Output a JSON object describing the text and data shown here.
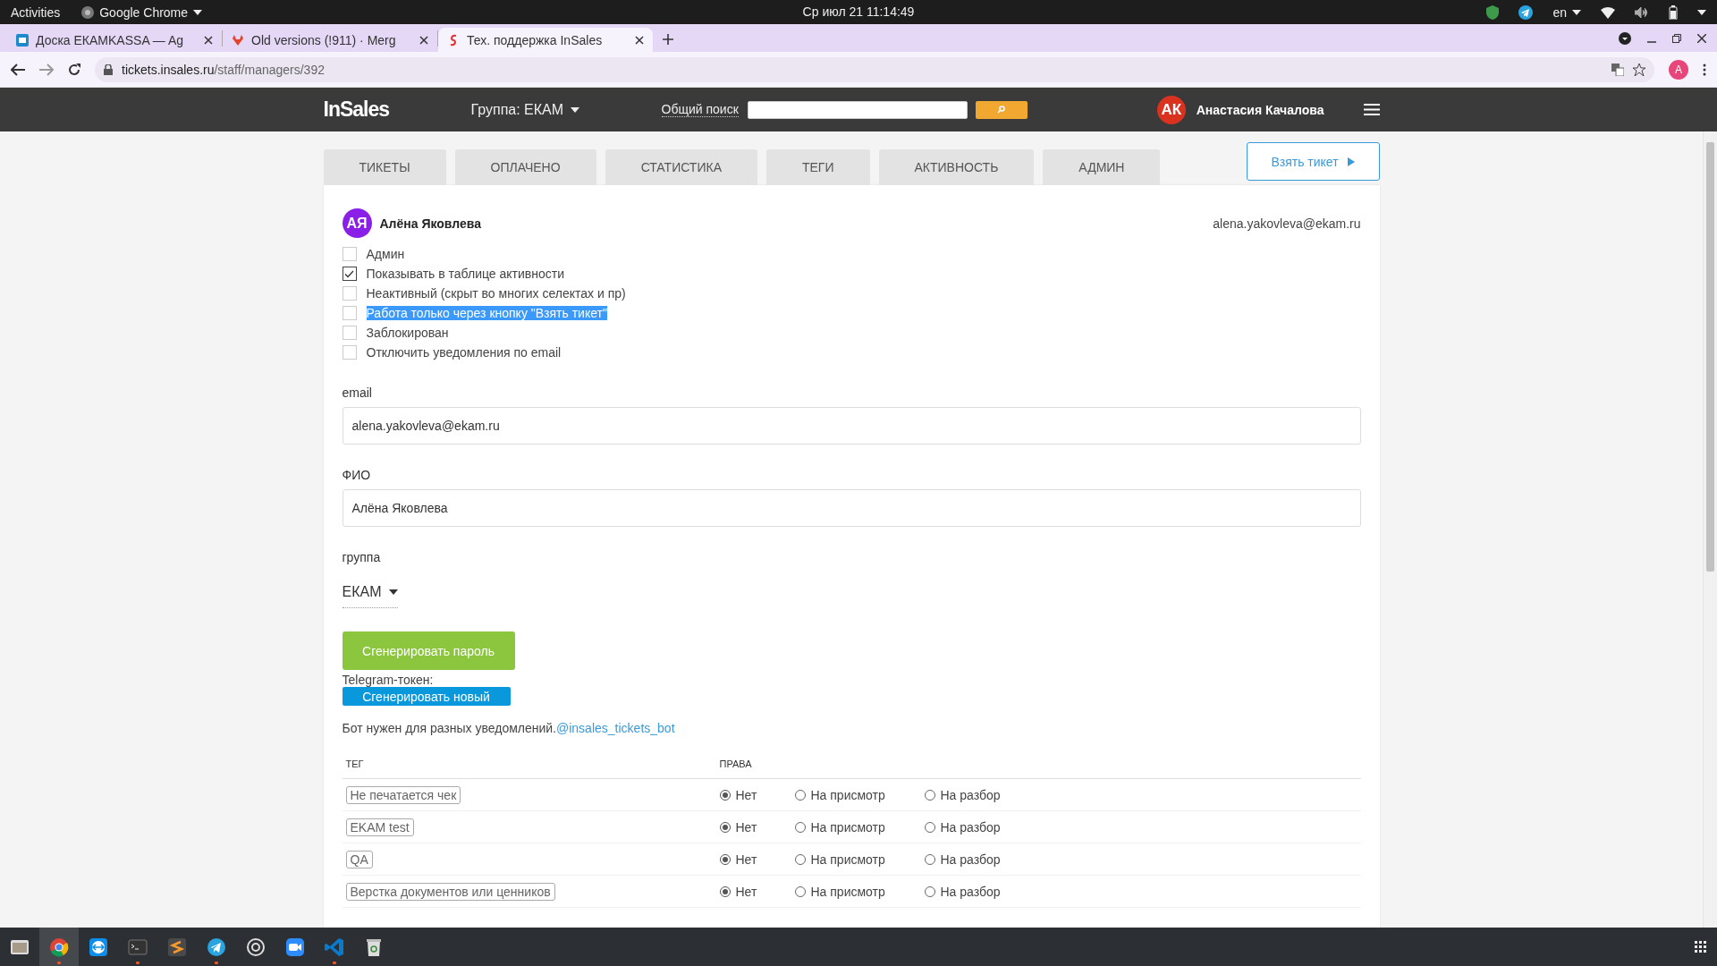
{
  "system_bar": {
    "activities": "Activities",
    "app_name": "Google Chrome",
    "clock": "Ср июл 21  11:14:49",
    "language": "en"
  },
  "browser": {
    "tabs": [
      {
        "title": "Доска ЕКАМKASSA — Ag",
        "selected": false
      },
      {
        "title": "Old versions (!911) · Merg",
        "selected": false
      },
      {
        "title": "Тех. поддержка InSales",
        "selected": true
      }
    ],
    "url_host": "tickets.insales.ru",
    "url_path": "/staff/managers/392",
    "profile_initial": "A"
  },
  "app_header": {
    "logo": "InSales",
    "group": "Группа: ЕКАМ",
    "search_label": "Общий поиск",
    "user_initials": "АК",
    "user_name": "Анастасия Качалова"
  },
  "nav_tabs": [
    {
      "label": "ТИКЕТЫ",
      "selected": false
    },
    {
      "label": "ОПЛАЧЕНО",
      "selected": false
    },
    {
      "label": "СТАТИСТИКА",
      "selected": false
    },
    {
      "label": "ТЕГИ",
      "selected": false
    },
    {
      "label": "АКТИВНОСТЬ",
      "selected": false
    },
    {
      "label": "АДМИН",
      "selected": false
    }
  ],
  "take_ticket_button": "Взять тикет",
  "manager": {
    "initials": "АЯ",
    "name": "Алёна Яковлева",
    "email": "alena.yakovleva@ekam.ru",
    "checkboxes": [
      {
        "label": "Админ",
        "checked": false,
        "highlighted": false
      },
      {
        "label": "Показывать в таблице активности",
        "checked": true,
        "highlighted": false
      },
      {
        "label": "Неактивный (скрыт во многих селектах и пр)",
        "checked": false,
        "highlighted": false
      },
      {
        "label": "Работа только через кнопку \"Взять тикет\"",
        "checked": false,
        "highlighted": true
      },
      {
        "label": "Заблокирован",
        "checked": false,
        "highlighted": false
      },
      {
        "label": "Отключить уведомления по email",
        "checked": false,
        "highlighted": false
      }
    ],
    "fields": [
      {
        "label": "email",
        "value": "alena.yakovleva@ekam.ru"
      },
      {
        "label": "ФИО",
        "value": "Алёна Яковлева"
      }
    ],
    "group": {
      "label": "группа",
      "value": "ЕКАМ"
    },
    "generate_password_button": "Сгенерировать пароль",
    "telegram_label": "Telegram-токен:",
    "generate_token_button": "Сгенерировать новый",
    "bot_note": "Бот нужен для разных уведомлений.",
    "bot_link": "@insales_tickets_bot"
  },
  "tag_table": {
    "columns": [
      "ТЕГ",
      "ПРАВА"
    ],
    "rows": [
      {
        "tag": "Не печатается чек",
        "rights": [
          {
            "label": "Нет",
            "selected": true
          },
          {
            "label": "На присмотр",
            "selected": false
          },
          {
            "label": "На разбор",
            "selected": false
          }
        ]
      },
      {
        "tag": "EKAM test",
        "rights": [
          {
            "label": "Нет",
            "selected": true
          },
          {
            "label": "На присмотр",
            "selected": false
          },
          {
            "label": "На разбор",
            "selected": false
          }
        ]
      },
      {
        "tag": "QA",
        "rights": [
          {
            "label": "Нет",
            "selected": true
          },
          {
            "label": "На присмотр",
            "selected": false
          },
          {
            "label": "На разбор",
            "selected": false
          }
        ]
      },
      {
        "tag": "Верстка документов или ценников",
        "rights": [
          {
            "label": "Нет",
            "selected": true
          },
          {
            "label": "На присмотр",
            "selected": false
          },
          {
            "label": "На разбор",
            "selected": false
          }
        ]
      }
    ]
  }
}
